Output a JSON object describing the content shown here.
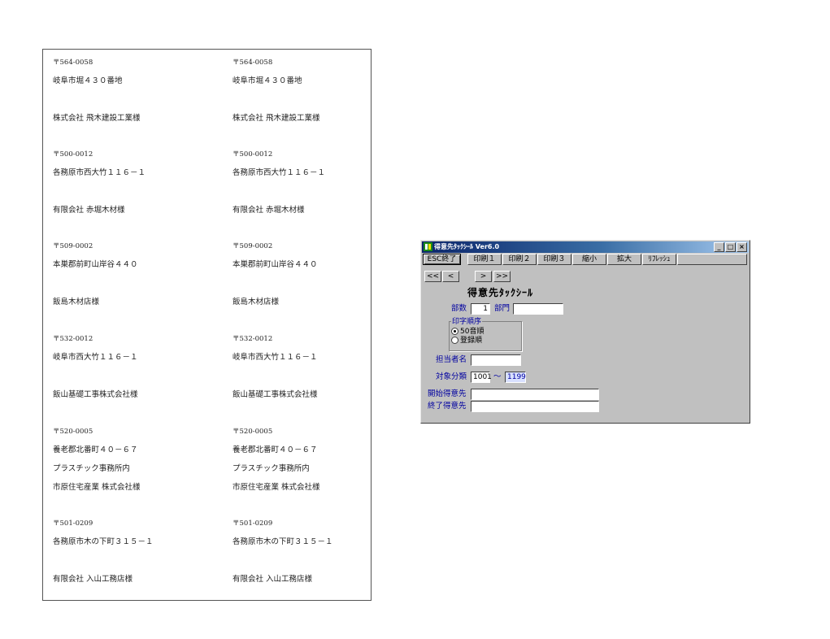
{
  "labels": [
    {
      "zip": "〒564-0058",
      "address": "岐阜市堀４３０番地",
      "extra": "",
      "name": "株式会社 飛木建設工業様"
    },
    {
      "zip": "〒500-0012",
      "address": "各務原市西大竹１１６－１",
      "extra": "",
      "name": "有限会社 赤堀木材様"
    },
    {
      "zip": "〒509-0002",
      "address": "本巣郡前町山岸谷４４０",
      "extra": "",
      "name": "飯島木材店様"
    },
    {
      "zip": "〒532-0012",
      "address": "岐阜市西大竹１１６－１",
      "extra": "",
      "name": "飯山基礎工事株式会社様"
    },
    {
      "zip": "〒520-0005",
      "address": "養老郡北番町４０－６７",
      "extra": "プラスチック事務所内",
      "name": "市原住宅産業 株式会社様"
    },
    {
      "zip": "〒501-0209",
      "address": "各務原市木の下町３１５－１",
      "extra": "",
      "name": "有限会社 入山工務店様"
    }
  ],
  "window": {
    "title": "得意先ﾀｯｸｼｰﾙ Ver6.0",
    "toolbar": [
      "ESC終了",
      "印刷１",
      "印刷２",
      "印刷３",
      "縮小",
      "拡大",
      "ﾘﾌﾚｯｼｭ"
    ],
    "nav": [
      "<<",
      "<",
      ">",
      ">>"
    ],
    "form_title": "得意先ﾀｯｸｼｰﾙ",
    "copies_label": "部数",
    "copies_value": "1",
    "dept_label": "部門",
    "dept_value": "",
    "print_order_label": "印字順序",
    "print_order_options": [
      "50音順",
      "登録順"
    ],
    "print_order_selected": "50音順",
    "staff_label": "担当者名",
    "staff_value": "",
    "category_label": "対象分類",
    "category_from": "1001",
    "category_tilde": "～",
    "category_to": "1199",
    "start_customer_label": "開始得意先",
    "end_customer_label": "終了得意先",
    "start_customer_value": "",
    "end_customer_value": ""
  }
}
